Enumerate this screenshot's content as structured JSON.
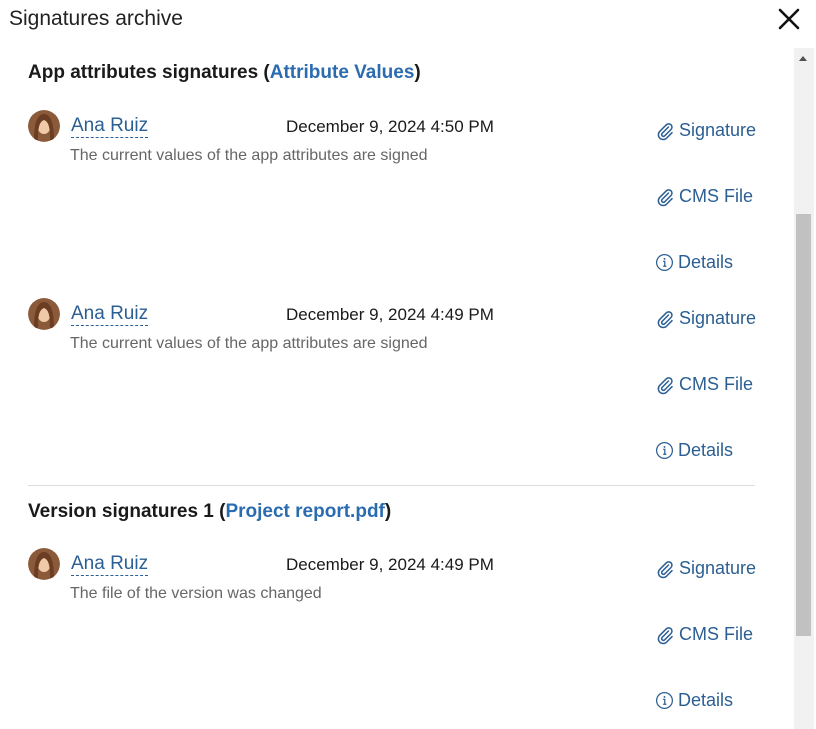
{
  "header": {
    "title": "Signatures archive"
  },
  "sections": [
    {
      "title_prefix": "App attributes signatures (",
      "title_link": "Attribute Values",
      "title_suffix": ")",
      "entries": [
        {
          "user": "Ana Ruiz",
          "timestamp": "December 9, 2024 4:50 PM",
          "description": "The current values of the app attributes are signed",
          "actions": {
            "signature": "Signature",
            "cms_file": "CMS File",
            "details": "Details"
          }
        },
        {
          "user": "Ana Ruiz",
          "timestamp": "December 9, 2024 4:49 PM",
          "description": "The current values of the app attributes are signed",
          "actions": {
            "signature": "Signature",
            "cms_file": "CMS File",
            "details": "Details"
          }
        }
      ]
    },
    {
      "title_prefix": "Version signatures 1 (",
      "title_link": "Project report.pdf",
      "title_suffix": ")",
      "entries": [
        {
          "user": "Ana Ruiz",
          "timestamp": "December 9, 2024 4:49 PM",
          "description": "The file of the version was changed",
          "actions": {
            "signature": "Signature",
            "cms_file": "CMS File",
            "details": "Details"
          }
        }
      ]
    }
  ],
  "icons": {
    "close": "close-icon",
    "attachment": "paperclip-icon",
    "info": "info-icon",
    "avatar": "user-avatar"
  },
  "colors": {
    "link": "#2b6cb0",
    "user_link": "#2b5f93",
    "muted_text": "#666666",
    "divider": "#dcdcdc"
  }
}
